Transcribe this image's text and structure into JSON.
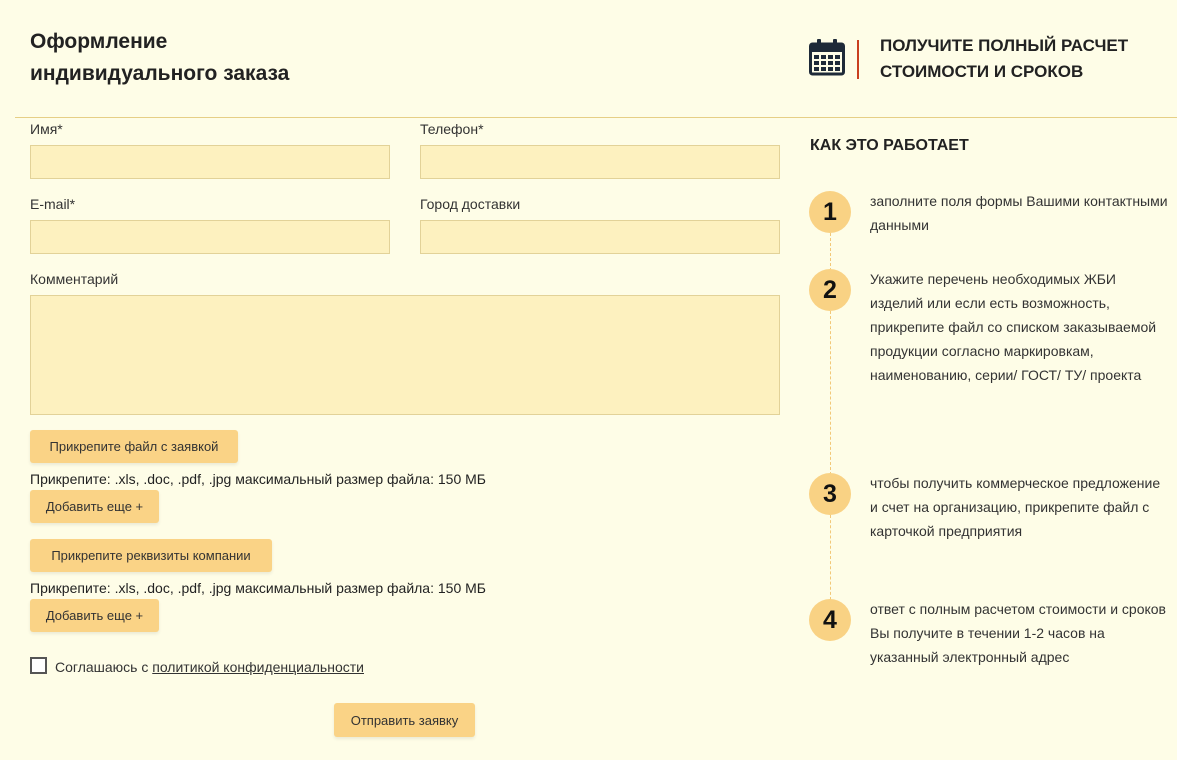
{
  "header": {
    "title_line1": "Оформление",
    "title_line2": "индивидуального заказа"
  },
  "promo": {
    "icon": "calendar-icon",
    "line1": "ПОЛУЧИТЕ ПОЛНЫЙ РАСЧЕТ",
    "line2": "СТОИМОСТИ И СРОКОВ",
    "accent_color": "#c9401f"
  },
  "form": {
    "name_label": "Имя*",
    "name_value": "",
    "phone_label": "Телефон*",
    "phone_value": "",
    "email_label": "E-mail*",
    "email_value": "",
    "city_label": "Город доставки",
    "city_value": "",
    "comment_label": "Комментарий",
    "comment_value": "",
    "attach_file_button": "Прикрепите файл с заявкой",
    "attach_hint_1": "Прикрепите: .xls, .doc, .pdf, .jpg максимальный размер файла: 150 МБ",
    "add_more_button_1": "Добавить еще +",
    "attach_requisites_button": "Прикрепите реквизиты компании",
    "attach_hint_2": "Прикрепите: .xls, .doc, .pdf, .jpg максимальный размер файла: 150 МБ",
    "add_more_button_2": "Добавить еще +",
    "agree_prefix": "Соглашаюсь с ",
    "agree_link": "политикой конфиденциальности",
    "agree_checked": false,
    "submit_button": "Отправить заявку"
  },
  "how": {
    "title": "КАК ЭТО РАБОТАЕТ",
    "steps": [
      {
        "num": "1",
        "text": "заполните поля формы Вашими контактными данными"
      },
      {
        "num": "2",
        "text": "Укажите перечень необходимых ЖБИ изделий или если есть возможность, прикрепите файл со списком заказываемой продукции согласно маркировкам, наименованию, серии/ ГОСТ/ ТУ/ проекта"
      },
      {
        "num": "3",
        "text": "чтобы получить коммерческое предложение и счет на организацию, прикрепите файл с карточкой предприятия"
      },
      {
        "num": "4",
        "text": "ответ с полным расчетом стоимости и сроков Вы получите в течении 1-2 часов на указанный электронный адрес"
      }
    ]
  },
  "colors": {
    "background": "#fefde7",
    "input_fill": "#fdf1bf",
    "button_fill": "#fad386",
    "step_circle": "#f9d284"
  }
}
